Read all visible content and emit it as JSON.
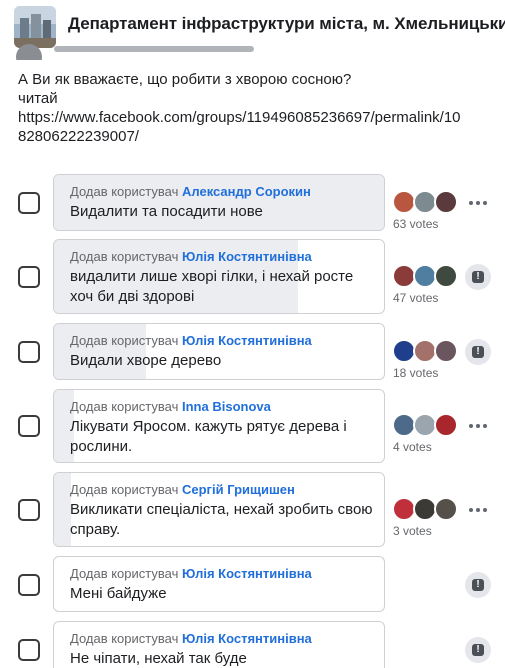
{
  "header": {
    "group_title": "Департамент інфраструктури міста, м. Хмельницький"
  },
  "post": {
    "text_lines": [
      "А Ви як вважаєте, що робити з хворою сосною?",
      "читай",
      "https://www.facebook.com/groups/119496085236697/permalink/10",
      "82806222239007/"
    ]
  },
  "poll": {
    "added_by_label": "Додав користувач",
    "options": [
      {
        "author": "Александр Сорокин",
        "text": "Видалити та посадити нове",
        "votes": "63 votes",
        "fill_fraction": 1.0,
        "has_more_menu": true,
        "has_report": false
      },
      {
        "author": "Юлія Костянтинівна",
        "text": "видалити лише хворі гілки, і нехай росте хоч би дві здорові",
        "votes": "47 votes",
        "fill_fraction": 0.74,
        "has_more_menu": false,
        "has_report": true
      },
      {
        "author": "Юлія Костянтинівна",
        "text": "Видали хворе дерево",
        "votes": "18 votes",
        "fill_fraction": 0.28,
        "has_more_menu": false,
        "has_report": true
      },
      {
        "author": "Inna Bisonova",
        "text": "Лікувати Яросом. кажуть рятує дерева і рослини.",
        "votes": "4 votes",
        "fill_fraction": 0.06,
        "has_more_menu": true,
        "has_report": false
      },
      {
        "author": "Сергій Грищишен",
        "text": "Викликати спеціаліста, нехай зробить свою справу.",
        "votes": "3 votes",
        "fill_fraction": 0.05,
        "has_more_menu": true,
        "has_report": false
      },
      {
        "author": "Юлія Костянтинівна",
        "text": "Мені байдуже",
        "votes": "",
        "fill_fraction": 0.0,
        "has_more_menu": false,
        "has_report": true
      },
      {
        "author": "Юлія Костянтинівна",
        "text": "Не чіпати, нехай так буде",
        "votes": "",
        "fill_fraction": 0.0,
        "has_more_menu": false,
        "has_report": true
      }
    ]
  },
  "colors": {
    "author_link": "#216fdb",
    "option_fill": "#ebedf0",
    "muted_text": "#65676b"
  }
}
